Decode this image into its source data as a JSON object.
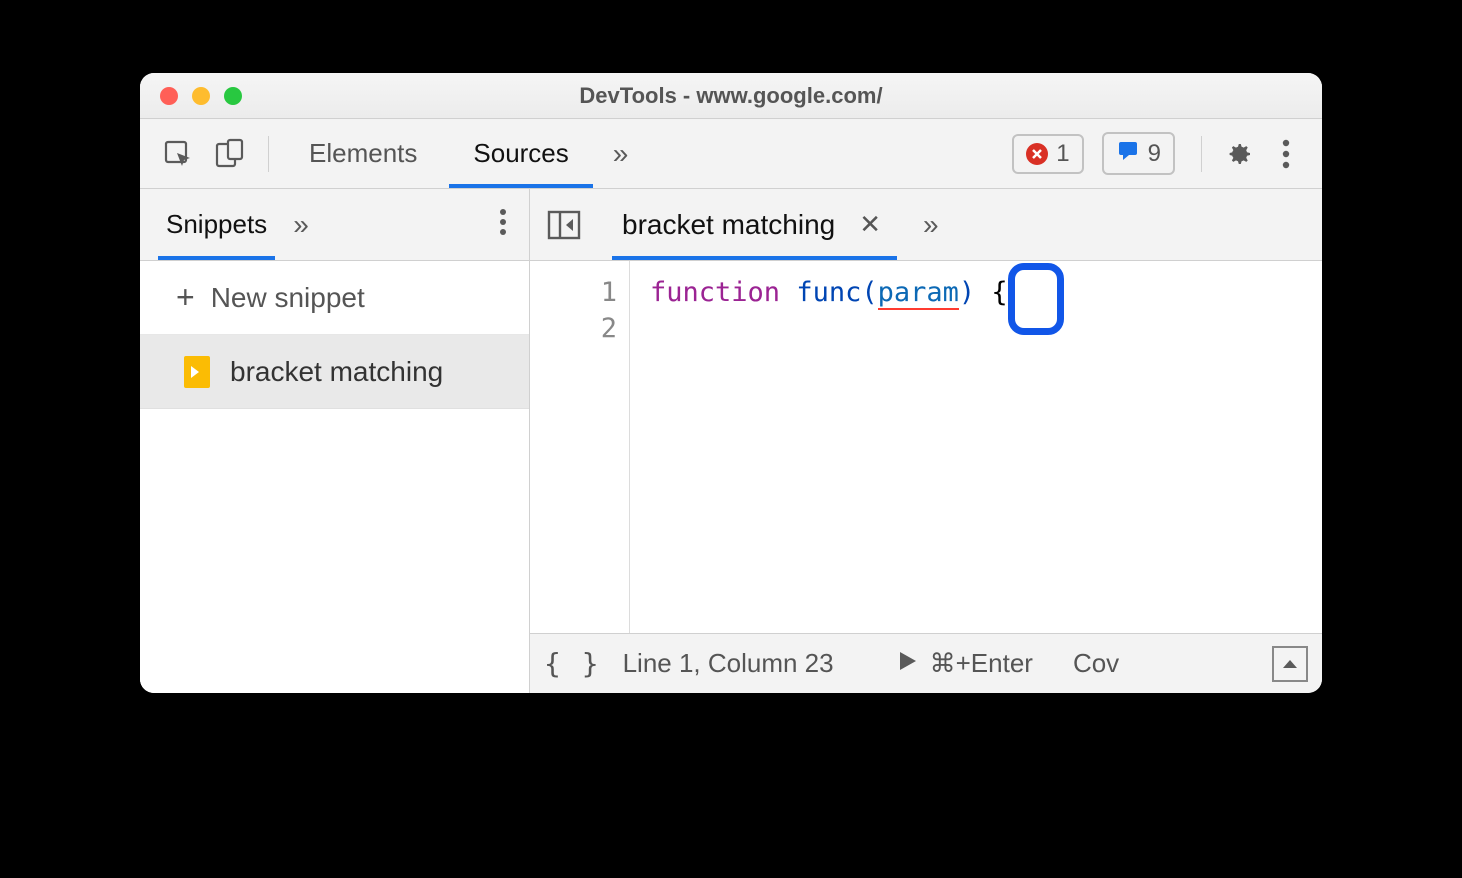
{
  "window": {
    "title": "DevTools - www.google.com/"
  },
  "toolbar": {
    "tabs": {
      "elements": "Elements",
      "sources": "Sources"
    },
    "overflow": "»",
    "errors_count": "1",
    "issues_count": "9"
  },
  "sidebar": {
    "tab_label": "Snippets",
    "overflow": "»",
    "new_snippet_label": "New snippet",
    "items": [
      {
        "name": "bracket matching"
      }
    ]
  },
  "editor": {
    "tab_name": "bracket matching",
    "overflow": "»",
    "lines": {
      "l1": "1",
      "l2": "2"
    },
    "code": {
      "keyword": "function",
      "fn_name": "func",
      "open_paren": "(",
      "param": "param",
      "close_paren": ")",
      "space": " ",
      "brace": "{"
    }
  },
  "statusbar": {
    "braces": "{ }",
    "cursor": "Line 1, Column 23",
    "run_hint": "⌘+Enter",
    "coverage": "Cov"
  }
}
